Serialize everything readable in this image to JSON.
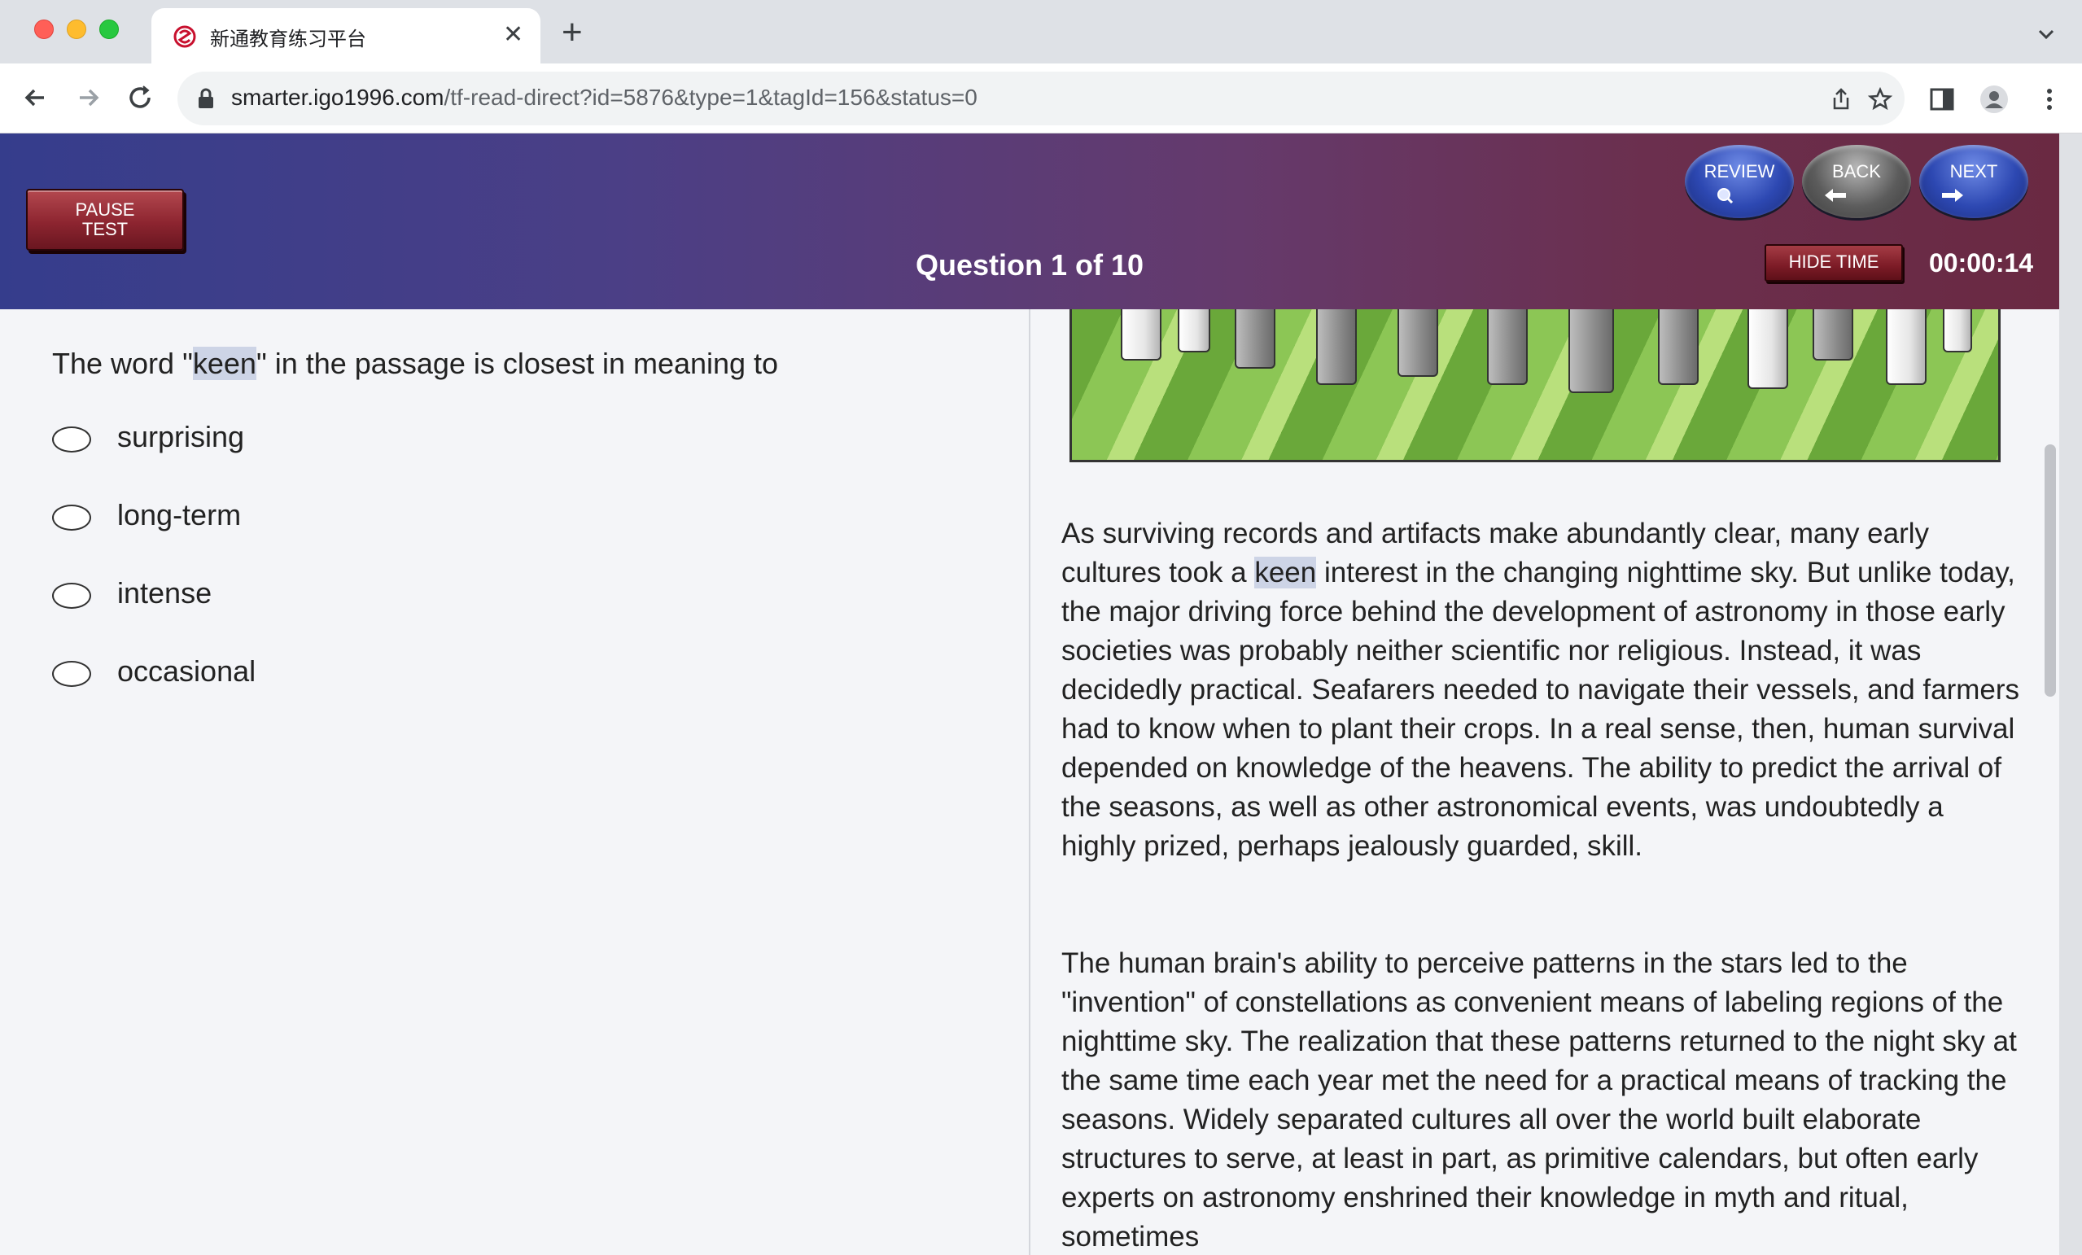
{
  "browser": {
    "tab_title": "新通教育练习平台",
    "url_host": "smarter.igo1996.com",
    "url_path": "/tf-read-direct?id=5876&type=1&tagId=156&status=0"
  },
  "header": {
    "pause_label_line1": "PAUSE",
    "pause_label_line2": "TEST",
    "question_counter": "Question 1 of 10",
    "review_label": "REVIEW",
    "back_label": "BACK",
    "next_label": "NEXT",
    "hide_time_label": "HIDE TIME",
    "timer": "00:00:14"
  },
  "question": {
    "stem_before": "The word \"",
    "stem_highlight": "keen",
    "stem_after": "\" in the passage is closest in meaning to",
    "options": [
      "surprising",
      "long-term",
      "intense",
      "occasional"
    ]
  },
  "passage": {
    "p1_before": "As surviving records and artifacts make abundantly clear, many early cultures took a ",
    "p1_highlight": "keen",
    "p1_after": " interest in the changing nighttime sky. But unlike today, the major driving force behind the development of astronomy in those early societies was probably neither scientific nor religious. Instead, it was decidedly practical. Seafarers needed to navigate their vessels, and farmers had to know when to plant their crops. In a real sense, then, human survival depended on knowledge of the heavens. The ability to predict the arrival of the seasons, as well as other astronomical events, was undoubtedly a highly prized, perhaps jealously guarded, skill.",
    "p2": "The human brain's ability to perceive patterns in the stars led to the \"invention\" of constellations as convenient means of labeling regions of the nighttime sky. The realization that these patterns returned to the night sky at the same time each year met the need for a practical means of tracking the seasons. Widely separated cultures all over the world built elaborate structures to serve, at least in part, as primitive calendars, but often early experts on astronomy enshrined their knowledge in myth and ritual, sometimes"
  }
}
